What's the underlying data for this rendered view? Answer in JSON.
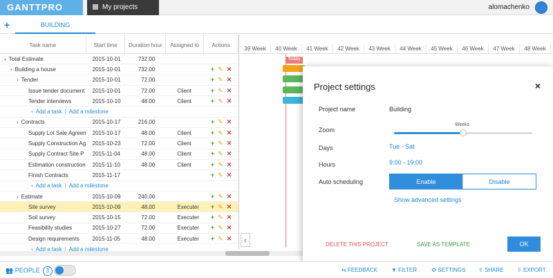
{
  "app": {
    "logo": "GANTTPRO",
    "tab": "My projects",
    "user": "alomachenko"
  },
  "tabs": {
    "add": "+",
    "active": "BUILDING"
  },
  "grid": {
    "headers": [
      "Task name",
      "Start time",
      "Duration hour",
      "Assigned to",
      "Actions"
    ],
    "rows": [
      {
        "name": "Total Estimate",
        "start": "2015-10-01",
        "duration": "732.00",
        "assigned": "",
        "indent": 0,
        "arrow": "›",
        "actions": false
      },
      {
        "name": "Building a house",
        "start": "2015-10-01",
        "duration": "732.00",
        "assigned": "",
        "indent": 1,
        "arrow": "›",
        "actions": true
      },
      {
        "name": "Tender",
        "start": "2015-10-01",
        "duration": "72.00",
        "assigned": "",
        "indent": 2,
        "arrow": "›",
        "actions": true
      },
      {
        "name": "Issue tender document",
        "start": "2015-10-01",
        "duration": "72.00",
        "assigned": "Client",
        "indent": 3,
        "arrow": "",
        "actions": true
      },
      {
        "name": "Tender interviews",
        "start": "2015-10-10",
        "duration": "48.00",
        "assigned": "Client",
        "indent": 3,
        "arrow": "",
        "actions": true
      },
      {
        "type": "add",
        "indent": 3
      },
      {
        "name": "Contracts",
        "start": "2015-10-17",
        "duration": "216.00",
        "assigned": "",
        "indent": 2,
        "arrow": "›",
        "actions": true
      },
      {
        "name": "Supply Lot Sale Agreem",
        "start": "2015-10-17",
        "duration": "48.00",
        "assigned": "Client",
        "indent": 3,
        "arrow": "",
        "actions": true
      },
      {
        "name": "Supply Construction Ag",
        "start": "2015-10-23",
        "duration": "72.00",
        "assigned": "Client",
        "indent": 3,
        "arrow": "",
        "actions": true
      },
      {
        "name": "Supply Contract Site P",
        "start": "2015-11-04",
        "duration": "48.00",
        "assigned": "Client",
        "indent": 3,
        "arrow": "",
        "actions": true
      },
      {
        "name": "Estimation construction",
        "start": "2015-11-10",
        "duration": "48.00",
        "assigned": "Client",
        "indent": 3,
        "arrow": "",
        "actions": true
      },
      {
        "name": "Finish Contracts",
        "start": "2015-11-17",
        "duration": "",
        "assigned": "",
        "indent": 3,
        "arrow": "",
        "actions": true
      },
      {
        "type": "add",
        "indent": 3
      },
      {
        "name": "Estimate",
        "start": "2015-10-09",
        "duration": "240.00",
        "assigned": "",
        "indent": 2,
        "arrow": "›",
        "actions": true
      },
      {
        "name": "Site survey",
        "start": "2015-10-09",
        "duration": "48.00",
        "assigned": "Executer",
        "indent": 3,
        "arrow": "",
        "actions": true,
        "highlight": true
      },
      {
        "name": "Soil survey",
        "start": "2015-10-15",
        "duration": "72.00",
        "assigned": "Executer",
        "indent": 3,
        "arrow": "",
        "actions": true
      },
      {
        "name": "Feasibility studies",
        "start": "2015-10-27",
        "duration": "72.00",
        "assigned": "Executer",
        "indent": 3,
        "arrow": "",
        "actions": true
      },
      {
        "name": "Design requirements",
        "start": "2015-11-05",
        "duration": "48.00",
        "assigned": "Executer",
        "indent": 3,
        "arrow": "",
        "actions": true
      },
      {
        "type": "add",
        "indent": 3
      }
    ],
    "add_task": "Add a task",
    "add_milestone": "Add a milestone",
    "separator": "|"
  },
  "gantt": {
    "weeks": [
      "39 Week",
      "40 Week",
      "41 Week",
      "42 Week",
      "43 Week",
      "44 Week",
      "45 Week",
      "46 Week",
      "47 Week",
      "48 Week"
    ],
    "today_label": "Today",
    "bars": [
      {
        "color": "#f4a21a"
      },
      {
        "color": "#5cb85c"
      },
      {
        "color": "#5cb85c"
      },
      {
        "color": "#3fb3d8"
      }
    ]
  },
  "modal": {
    "title": "Project settings",
    "close": "×",
    "project_name_label": "Project name",
    "project_name": "Building",
    "zoom_label": "Zoom",
    "zoom_value": "Weeks",
    "zoom_level": 0.5,
    "days_label": "Days",
    "days": "Tue - Sat",
    "hours_label": "Hours",
    "hours": "9:00 - 19:00",
    "auto_label": "Auto scheduling",
    "enable": "Enable",
    "disable": "Disable",
    "advanced": "Show advanced settings",
    "delete": "DELETE THIS PROJECT",
    "template": "SAVE AS TEMPLATE",
    "ok": "OK"
  },
  "bottom": {
    "people": "PEOPLE",
    "people_count": "3",
    "feedback": "FEEDBACK",
    "filter": "FILTER",
    "settings": "SETTINGS",
    "share": "SHARE",
    "export": "EXPORT"
  },
  "colors": {
    "accent": "#2f8ddb",
    "highlight_row": "#fdf1b8",
    "today": "#e87a7a"
  }
}
